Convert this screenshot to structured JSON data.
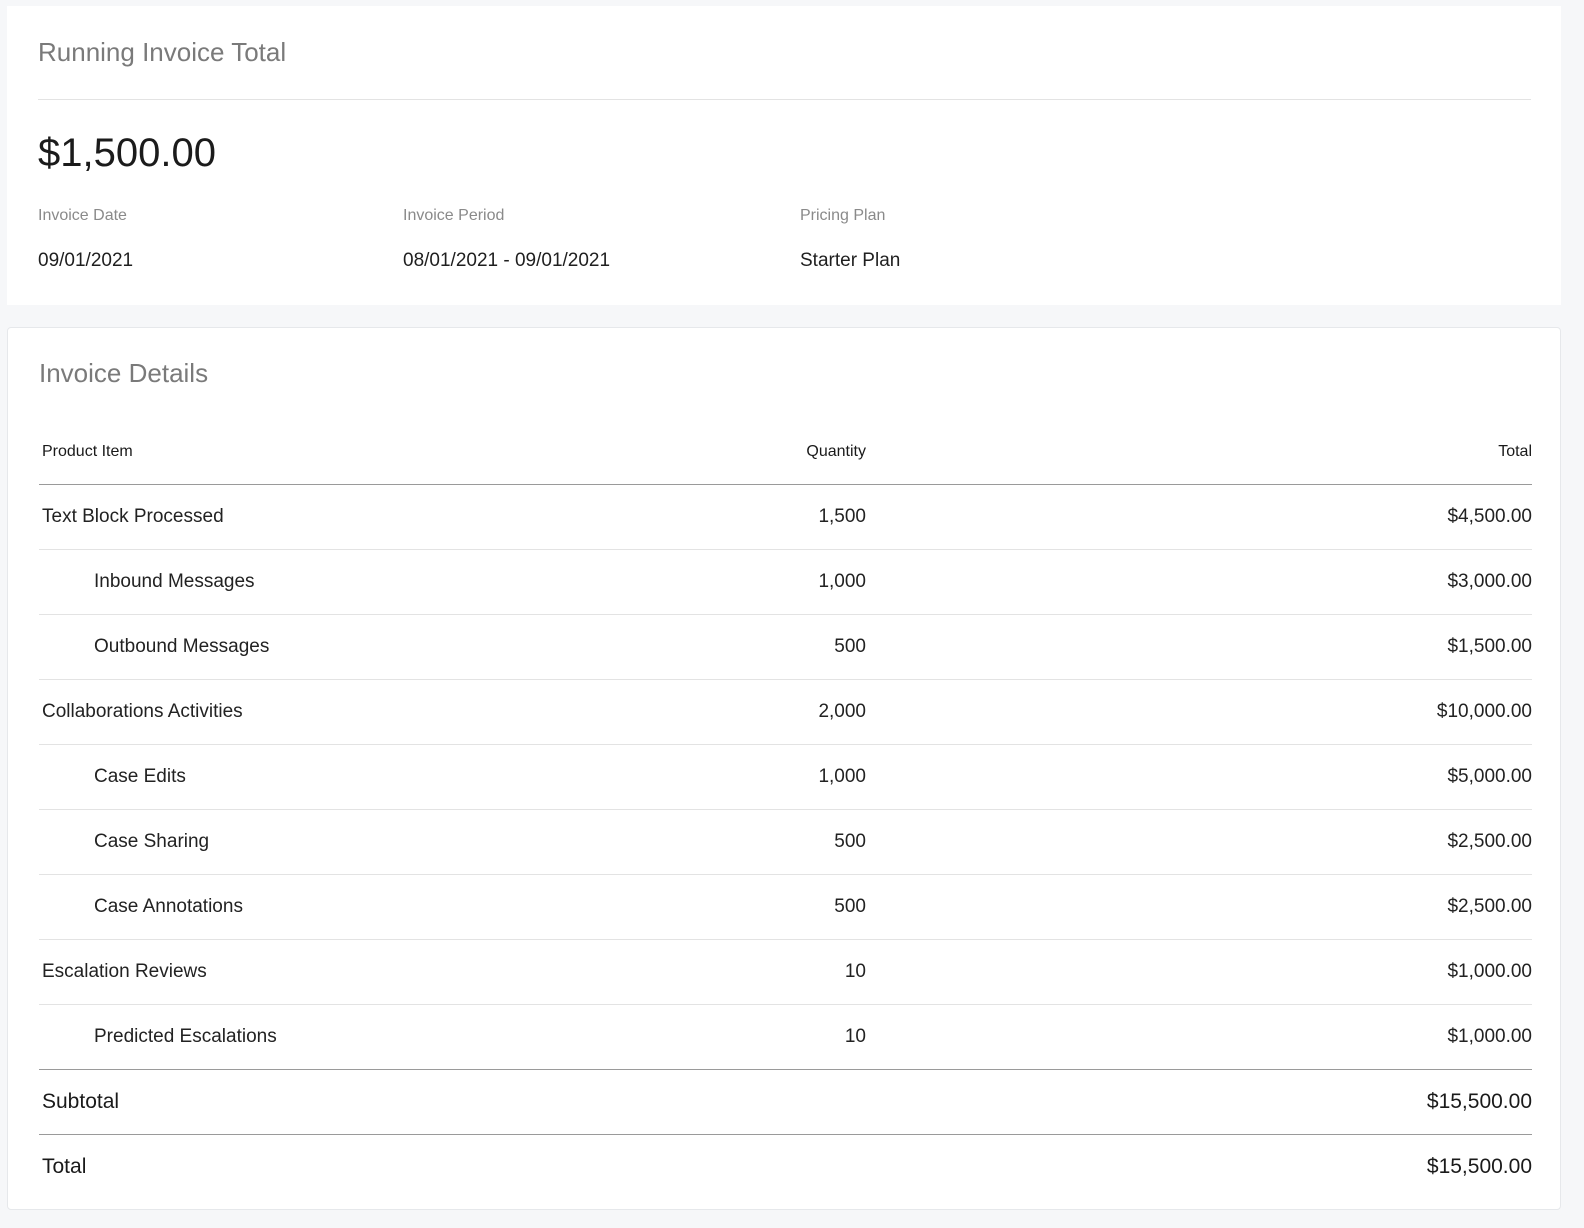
{
  "summary_card": {
    "title": "Running Invoice Total",
    "amount": "$1,500.00",
    "invoice_date_label": "Invoice Date",
    "invoice_date": "09/01/2021",
    "invoice_period_label": "Invoice Period",
    "invoice_period": "08/01/2021 - 09/01/2021",
    "pricing_plan_label": "Pricing Plan",
    "pricing_plan": "Starter Plan"
  },
  "details_card": {
    "title": "Invoice Details",
    "columns": {
      "item": "Product Item",
      "quantity": "Quantity",
      "total": "Total"
    },
    "rows": [
      {
        "item": "Text Block Processed",
        "quantity": "1,500",
        "total": "$4,500.00",
        "sub": false
      },
      {
        "item": "Inbound Messages",
        "quantity": "1,000",
        "total": "$3,000.00",
        "sub": true
      },
      {
        "item": "Outbound Messages",
        "quantity": "500",
        "total": "$1,500.00",
        "sub": true
      },
      {
        "item": "Collaborations Activities",
        "quantity": "2,000",
        "total": "$10,000.00",
        "sub": false
      },
      {
        "item": "Case Edits",
        "quantity": "1,000",
        "total": "$5,000.00",
        "sub": true
      },
      {
        "item": "Case Sharing",
        "quantity": "500",
        "total": "$2,500.00",
        "sub": true
      },
      {
        "item": "Case Annotations",
        "quantity": "500",
        "total": "$2,500.00",
        "sub": true
      },
      {
        "item": "Escalation Reviews",
        "quantity": "10",
        "total": "$1,000.00",
        "sub": false
      },
      {
        "item": "Predicted Escalations",
        "quantity": "10",
        "total": "$1,000.00",
        "sub": true
      }
    ],
    "subtotal_label": "Subtotal",
    "subtotal_value": "$15,500.00",
    "total_label": "Total",
    "total_value": "$15,500.00"
  },
  "colors": {
    "link": "#2a79c7",
    "background": "#f6f7f9"
  }
}
